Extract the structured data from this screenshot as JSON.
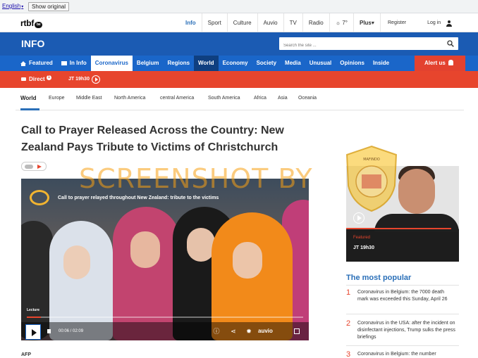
{
  "translate_bar": {
    "language": "English",
    "show_original": "Show original"
  },
  "top_nav": {
    "logo": "rtbf",
    "logo_badge": "be",
    "links": [
      "Info",
      "Sport",
      "Culture",
      "Auvio",
      "TV",
      "Radio",
      "7°",
      "Plus"
    ],
    "register": "Register",
    "login": "Log in"
  },
  "header": {
    "site_name": "INFO",
    "search_placeholder": "Search the site ..."
  },
  "menu": {
    "items": [
      "Featured",
      "In Info",
      "Coronavirus",
      "Belgium",
      "Regions",
      "World",
      "Economy",
      "Society",
      "Media",
      "Unusual",
      "Opinions",
      "Inside"
    ],
    "alert": "Alert us"
  },
  "direct_bar": {
    "label": "Direct",
    "count": "1",
    "jt": "JT 19h30"
  },
  "sub_nav": {
    "items": [
      "World",
      "Europe",
      "Middle East",
      "North America",
      "central America",
      "South America",
      "Africa",
      "Asia",
      "Oceania"
    ]
  },
  "article": {
    "headline": "Call to Prayer Released Across the Country: New Zealand Pays Tribute to Victims of Christchurch",
    "video_title": "Call to prayer relayed throughout New Zealand: tribute to the victims",
    "video_label": "Lecture",
    "video_time": "00:06  /  02:09",
    "video_progress": 0.05,
    "video_brand": "auvio",
    "source": "AFP"
  },
  "promo": {
    "label": "Featured",
    "title": "JT 19h30",
    "progress": 0.93
  },
  "most_popular": {
    "title": "The most popular",
    "items": [
      {
        "num": "1",
        "text": "Coronavirus in Belgium: the 7000 death mark was exceeded this Sunday, April 26"
      },
      {
        "num": "2",
        "text": "Coronavirus in the USA: after the incident on disinfectant injections, Trump sulks the press briefings"
      },
      {
        "num": "3",
        "text": "Coronavirus in Belgium: the number"
      }
    ]
  },
  "watermark": {
    "text": "SCREENSHOT BY",
    "seal_top": "MASYARAKAT ANTI FITNAH INDONESIA",
    "seal_center": "TURN BACK HOAX",
    "seal_id": "ID"
  },
  "colors": {
    "brand_blue": "#1b5bb3",
    "menu_blue": "#1a66c9",
    "accent_red": "#e7452d",
    "watermark_orange": "#f7a014"
  }
}
